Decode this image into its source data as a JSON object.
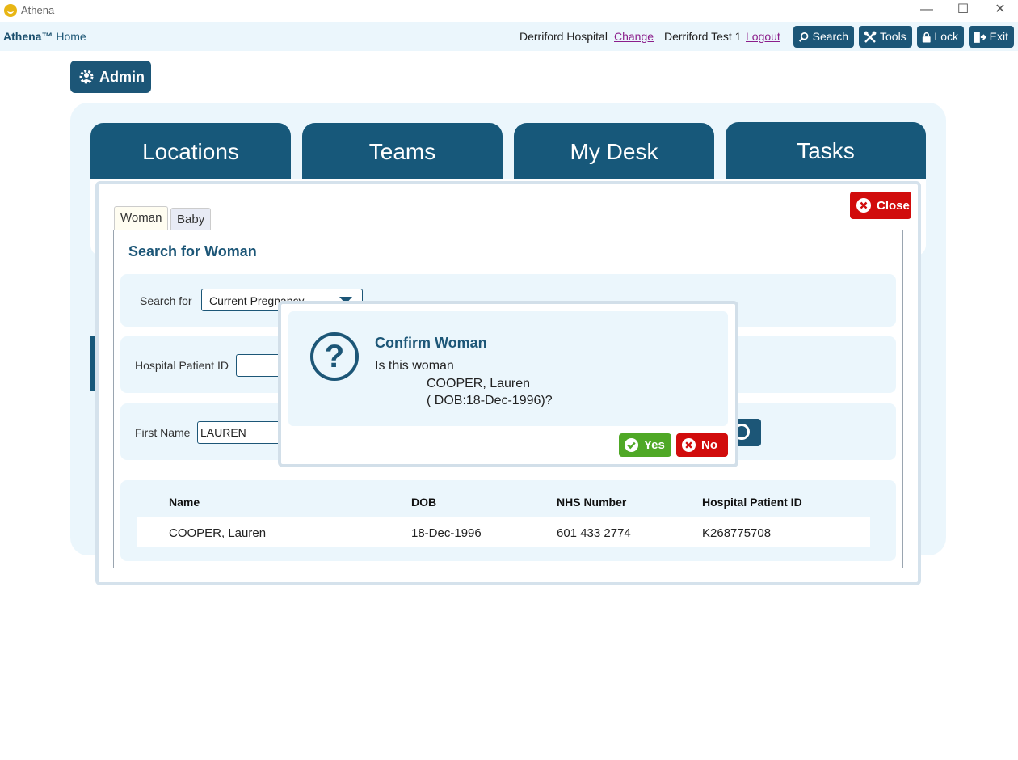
{
  "window": {
    "title": "Athena",
    "minimize": "—",
    "maximize": "☐",
    "close": "✕"
  },
  "topnav": {
    "brand": "Athena™",
    "home": "Home",
    "hospital": "Derriford Hospital",
    "change_link": "Change",
    "user": "Derriford Test 1",
    "logout_link": "Logout",
    "search_btn": "Search",
    "tools_btn": "Tools",
    "lock_btn": "Lock",
    "exit_btn": "Exit"
  },
  "admin": {
    "label": "Admin"
  },
  "tiles": [
    "Locations",
    "Teams",
    "My Desk",
    "Tasks"
  ],
  "dialog": {
    "close_label": "Close",
    "tabs": [
      "Woman",
      "Baby"
    ],
    "heading": "Search for Woman",
    "search_for_label": "Search for",
    "search_for_value": "Current Pregnancy",
    "hospital_id_label": "Hospital Patient ID",
    "hospital_id_value": "",
    "first_name_label": "First Name",
    "first_name_value": "LAUREN",
    "columns": [
      "Name",
      "DOB",
      "NHS Number",
      "Hospital Patient ID"
    ],
    "rows": [
      {
        "name": "COOPER, Lauren",
        "dob": "18-Dec-1996",
        "nhs": "601 433 2774",
        "hpid": "K268775708"
      }
    ]
  },
  "confirm": {
    "title": "Confirm Woman",
    "line1": "Is this woman",
    "line2": "COOPER, Lauren",
    "line3": "( DOB:18-Dec-1996)?",
    "yes": "Yes",
    "no": "No"
  },
  "colors": {
    "primary": "#1c5677",
    "panel": "#ebf6fc",
    "danger": "#d10c0c",
    "success": "#4fa826"
  }
}
